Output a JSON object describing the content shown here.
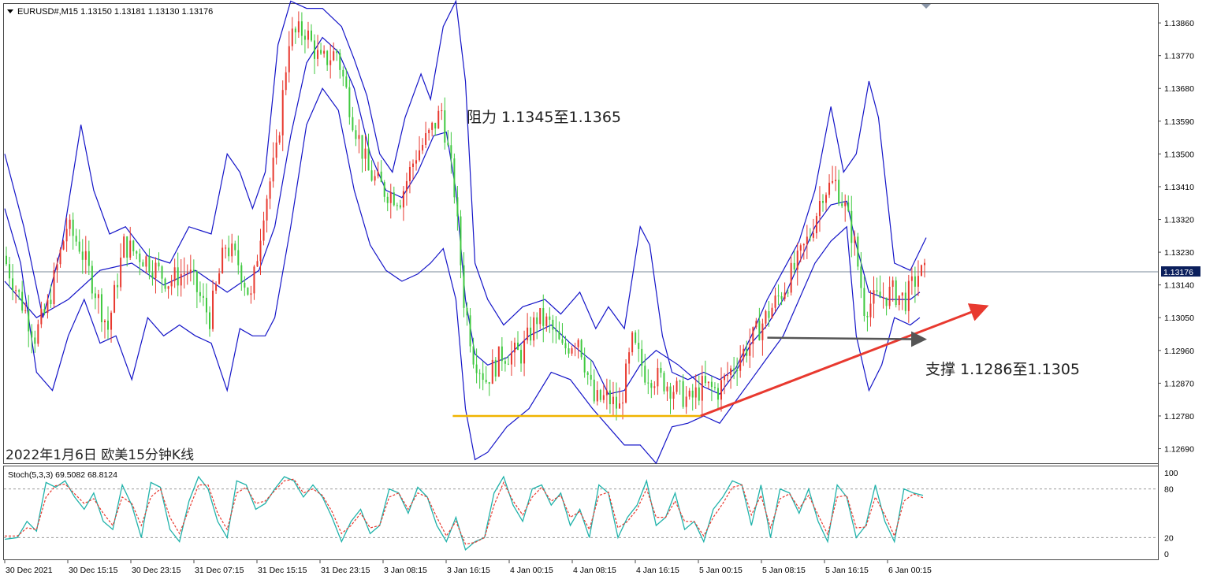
{
  "header": {
    "symbol_text": "EURUSD#,M15  1.13150 1.13181 1.13130 1.13176"
  },
  "stoch": {
    "label": "Stoch(5,3,3) 69.5082 68.8124",
    "levels": [
      100,
      80,
      20,
      0
    ]
  },
  "annotations": {
    "resistance": "阻力 1.1345至1.1365",
    "support": "支撑 1.1286至1.1305",
    "chart_date": "2022年1月6日 欧美15分钟K线"
  },
  "colors": {
    "bull": "#e8392f",
    "bear": "#3fc93f",
    "bands": "#1414c8",
    "support_arrow": "#e8392f",
    "horizontal_arrow": "#555555",
    "base_line": "#f0b400",
    "stoch_main": "#20b2aa",
    "stoch_signal": "#e8392f",
    "price_line": "#7a8a9a"
  },
  "chart_data": {
    "type": "candlestick",
    "ylim": [
      1.1265,
      1.1391
    ],
    "y_ticks": [
      "1.13860",
      "1.13770",
      "1.13680",
      "1.13590",
      "1.13500",
      "1.13410",
      "1.13320",
      "1.13230",
      "1.13140",
      "1.13050",
      "1.12960",
      "1.12870",
      "1.12780",
      "1.12690"
    ],
    "current_price": "1.13176",
    "x_labels": [
      "30 Dec 2021",
      "30 Dec 15:15",
      "30 Dec 23:15",
      "31 Dec 07:15",
      "31 Dec 15:15",
      "31 Dec 23:15",
      "3 Jan 08:15",
      "3 Jan 16:15",
      "4 Jan 00:15",
      "4 Jan 08:15",
      "4 Jan 16:15",
      "5 Jan 00:15",
      "5 Jan 08:15",
      "5 Jan 16:15",
      "6 Jan 00:15"
    ],
    "middle_band": [
      [
        0,
        1.1315
      ],
      [
        10,
        1.1305
      ],
      [
        20,
        1.131
      ],
      [
        30,
        1.1318
      ],
      [
        40,
        1.132
      ],
      [
        50,
        1.1314
      ],
      [
        60,
        1.1318
      ],
      [
        70,
        1.1312
      ],
      [
        80,
        1.1318
      ],
      [
        85,
        1.133
      ],
      [
        90,
        1.1355
      ],
      [
        95,
        1.1375
      ],
      [
        100,
        1.1382
      ],
      [
        105,
        1.1378
      ],
      [
        110,
        1.1368
      ],
      [
        115,
        1.135
      ],
      [
        120,
        1.134
      ],
      [
        125,
        1.1338
      ],
      [
        130,
        1.1345
      ],
      [
        135,
        1.1355
      ],
      [
        139,
        1.1356
      ],
      [
        142,
        1.134
      ],
      [
        145,
        1.131
      ],
      [
        148,
        1.1295
      ],
      [
        152,
        1.1292
      ],
      [
        158,
        1.1294
      ],
      [
        165,
        1.13
      ],
      [
        172,
        1.1303
      ],
      [
        178,
        1.1298
      ],
      [
        185,
        1.1293
      ],
      [
        190,
        1.1284
      ],
      [
        195,
        1.1285
      ],
      [
        200,
        1.1292
      ],
      [
        205,
        1.1296
      ],
      [
        212,
        1.1292
      ],
      [
        220,
        1.1286
      ],
      [
        225,
        1.1284
      ],
      [
        230,
        1.129
      ],
      [
        235,
        1.1298
      ],
      [
        240,
        1.1303
      ],
      [
        245,
        1.131
      ],
      [
        250,
        1.132
      ],
      [
        255,
        1.133
      ],
      [
        260,
        1.1336
      ],
      [
        265,
        1.1337
      ],
      [
        268,
        1.1325
      ],
      [
        272,
        1.1312
      ],
      [
        278,
        1.131
      ],
      [
        285,
        1.131
      ],
      [
        288,
        1.1312
      ]
    ],
    "upper_band": [
      [
        0,
        1.135
      ],
      [
        6,
        1.133
      ],
      [
        12,
        1.1305
      ],
      [
        18,
        1.1325
      ],
      [
        24,
        1.1358
      ],
      [
        28,
        1.134
      ],
      [
        33,
        1.1328
      ],
      [
        38,
        1.133
      ],
      [
        45,
        1.1322
      ],
      [
        52,
        1.132
      ],
      [
        58,
        1.133
      ],
      [
        65,
        1.1328
      ],
      [
        70,
        1.135
      ],
      [
        74,
        1.1345
      ],
      [
        78,
        1.1335
      ],
      [
        82,
        1.1345
      ],
      [
        86,
        1.138
      ],
      [
        90,
        1.1392
      ],
      [
        95,
        1.139
      ],
      [
        100,
        1.139
      ],
      [
        106,
        1.1385
      ],
      [
        110,
        1.1376
      ],
      [
        114,
        1.1366
      ],
      [
        118,
        1.135
      ],
      [
        122,
        1.1345
      ],
      [
        126,
        1.136
      ],
      [
        131,
        1.1372
      ],
      [
        134,
        1.1365
      ],
      [
        138,
        1.1385
      ],
      [
        142,
        1.1392
      ],
      [
        145,
        1.137
      ],
      [
        148,
        1.132
      ],
      [
        152,
        1.131
      ],
      [
        157,
        1.1303
      ],
      [
        163,
        1.1308
      ],
      [
        170,
        1.131
      ],
      [
        175,
        1.1306
      ],
      [
        181,
        1.1312
      ],
      [
        186,
        1.1302
      ],
      [
        190,
        1.1308
      ],
      [
        195,
        1.1302
      ],
      [
        200,
        1.133
      ],
      [
        203,
        1.1325
      ],
      [
        207,
        1.13
      ],
      [
        210,
        1.129
      ],
      [
        215,
        1.1288
      ],
      [
        220,
        1.129
      ],
      [
        225,
        1.1288
      ],
      [
        230,
        1.1291
      ],
      [
        235,
        1.13
      ],
      [
        240,
        1.131
      ],
      [
        245,
        1.1318
      ],
      [
        250,
        1.1326
      ],
      [
        255,
        1.134
      ],
      [
        260,
        1.1363
      ],
      [
        264,
        1.1345
      ],
      [
        268,
        1.135
      ],
      [
        272,
        1.137
      ],
      [
        275,
        1.136
      ],
      [
        280,
        1.132
      ],
      [
        285,
        1.1318
      ],
      [
        290,
        1.1327
      ]
    ],
    "lower_band": [
      [
        0,
        1.1335
      ],
      [
        5,
        1.132
      ],
      [
        10,
        1.129
      ],
      [
        15,
        1.1285
      ],
      [
        20,
        1.13
      ],
      [
        25,
        1.131
      ],
      [
        30,
        1.1298
      ],
      [
        35,
        1.13
      ],
      [
        40,
        1.1288
      ],
      [
        45,
        1.1305
      ],
      [
        50,
        1.13
      ],
      [
        55,
        1.1303
      ],
      [
        60,
        1.13
      ],
      [
        65,
        1.1298
      ],
      [
        70,
        1.1285
      ],
      [
        74,
        1.1302
      ],
      [
        78,
        1.13
      ],
      [
        82,
        1.13
      ],
      [
        85,
        1.1305
      ],
      [
        90,
        1.133
      ],
      [
        95,
        1.1358
      ],
      [
        100,
        1.1368
      ],
      [
        105,
        1.1362
      ],
      [
        110,
        1.134
      ],
      [
        115,
        1.1325
      ],
      [
        120,
        1.1318
      ],
      [
        125,
        1.1315
      ],
      [
        130,
        1.1317
      ],
      [
        134,
        1.132
      ],
      [
        138,
        1.1324
      ],
      [
        142,
        1.131
      ],
      [
        145,
        1.128
      ],
      [
        148,
        1.1266
      ],
      [
        152,
        1.1268
      ],
      [
        158,
        1.1275
      ],
      [
        165,
        1.128
      ],
      [
        172,
        1.129
      ],
      [
        178,
        1.1288
      ],
      [
        185,
        1.128
      ],
      [
        190,
        1.1275
      ],
      [
        195,
        1.127
      ],
      [
        200,
        1.127
      ],
      [
        205,
        1.1265
      ],
      [
        210,
        1.1275
      ],
      [
        215,
        1.1276
      ],
      [
        220,
        1.1278
      ],
      [
        225,
        1.1276
      ],
      [
        230,
        1.1282
      ],
      [
        235,
        1.1288
      ],
      [
        240,
        1.1294
      ],
      [
        245,
        1.13
      ],
      [
        250,
        1.131
      ],
      [
        255,
        1.132
      ],
      [
        260,
        1.1326
      ],
      [
        265,
        1.133
      ],
      [
        268,
        1.13
      ],
      [
        272,
        1.1285
      ],
      [
        276,
        1.1292
      ],
      [
        280,
        1.1305
      ],
      [
        285,
        1.1303
      ],
      [
        288,
        1.1305
      ]
    ],
    "close_path": [
      [
        0,
        1.1322
      ],
      [
        10,
        1.13
      ],
      [
        14,
        1.1308
      ],
      [
        20,
        1.133
      ],
      [
        24,
        1.1325
      ],
      [
        28,
        1.1315
      ],
      [
        33,
        1.1302
      ],
      [
        38,
        1.1325
      ],
      [
        45,
        1.1321
      ],
      [
        52,
        1.1315
      ],
      [
        58,
        1.1318
      ],
      [
        65,
        1.1305
      ],
      [
        70,
        1.1325
      ],
      [
        74,
        1.132
      ],
      [
        78,
        1.131
      ],
      [
        82,
        1.1335
      ],
      [
        86,
        1.135
      ],
      [
        90,
        1.1382
      ],
      [
        95,
        1.1384
      ],
      [
        100,
        1.1375
      ],
      [
        105,
        1.1378
      ],
      [
        110,
        1.136
      ],
      [
        115,
        1.1345
      ],
      [
        120,
        1.134
      ],
      [
        125,
        1.1338
      ],
      [
        130,
        1.135
      ],
      [
        134,
        1.1355
      ],
      [
        138,
        1.1362
      ],
      [
        142,
        1.134
      ],
      [
        145,
        1.131
      ],
      [
        148,
        1.1295
      ],
      [
        152,
        1.1288
      ],
      [
        157,
        1.1295
      ],
      [
        163,
        1.1295
      ],
      [
        168,
        1.1305
      ],
      [
        172,
        1.1303
      ],
      [
        176,
        1.1296
      ],
      [
        181,
        1.13
      ],
      [
        186,
        1.1282
      ],
      [
        190,
        1.1283
      ],
      [
        194,
        1.128
      ],
      [
        198,
        1.1298
      ],
      [
        202,
        1.129
      ],
      [
        207,
        1.1288
      ],
      [
        212,
        1.1285
      ],
      [
        216,
        1.1282
      ],
      [
        220,
        1.1286
      ],
      [
        225,
        1.1285
      ],
      [
        230,
        1.1292
      ],
      [
        235,
        1.1298
      ],
      [
        240,
        1.1305
      ],
      [
        245,
        1.1312
      ],
      [
        250,
        1.132
      ],
      [
        254,
        1.1328
      ],
      [
        258,
        1.134
      ],
      [
        262,
        1.1342
      ],
      [
        265,
        1.1335
      ],
      [
        268,
        1.1325
      ],
      [
        271,
        1.1308
      ],
      [
        275,
        1.131
      ],
      [
        280,
        1.1312
      ],
      [
        284,
        1.131
      ],
      [
        288,
        1.1317
      ]
    ],
    "stoch_values": [
      [
        0,
        18
      ],
      [
        4,
        20
      ],
      [
        7,
        40
      ],
      [
        10,
        28
      ],
      [
        13,
        88
      ],
      [
        16,
        82
      ],
      [
        19,
        90
      ],
      [
        22,
        70
      ],
      [
        25,
        55
      ],
      [
        28,
        75
      ],
      [
        31,
        40
      ],
      [
        34,
        30
      ],
      [
        37,
        85
      ],
      [
        40,
        60
      ],
      [
        43,
        20
      ],
      [
        46,
        88
      ],
      [
        49,
        82
      ],
      [
        52,
        30
      ],
      [
        55,
        15
      ],
      [
        58,
        65
      ],
      [
        61,
        95
      ],
      [
        64,
        80
      ],
      [
        67,
        40
      ],
      [
        70,
        20
      ],
      [
        73,
        90
      ],
      [
        76,
        85
      ],
      [
        79,
        55
      ],
      [
        82,
        62
      ],
      [
        85,
        80
      ],
      [
        88,
        95
      ],
      [
        91,
        90
      ],
      [
        94,
        70
      ],
      [
        97,
        85
      ],
      [
        100,
        70
      ],
      [
        103,
        45
      ],
      [
        106,
        15
      ],
      [
        109,
        40
      ],
      [
        112,
        55
      ],
      [
        115,
        25
      ],
      [
        118,
        35
      ],
      [
        121,
        80
      ],
      [
        124,
        75
      ],
      [
        127,
        50
      ],
      [
        130,
        82
      ],
      [
        133,
        70
      ],
      [
        136,
        35
      ],
      [
        139,
        15
      ],
      [
        142,
        45
      ],
      [
        145,
        5
      ],
      [
        148,
        15
      ],
      [
        151,
        20
      ],
      [
        154,
        75
      ],
      [
        157,
        95
      ],
      [
        160,
        60
      ],
      [
        163,
        40
      ],
      [
        166,
        80
      ],
      [
        169,
        85
      ],
      [
        172,
        60
      ],
      [
        175,
        75
      ],
      [
        178,
        35
      ],
      [
        181,
        55
      ],
      [
        184,
        20
      ],
      [
        187,
        85
      ],
      [
        190,
        75
      ],
      [
        193,
        20
      ],
      [
        196,
        45
      ],
      [
        199,
        60
      ],
      [
        202,
        90
      ],
      [
        205,
        35
      ],
      [
        208,
        45
      ],
      [
        211,
        75
      ],
      [
        214,
        30
      ],
      [
        217,
        40
      ],
      [
        220,
        15
      ],
      [
        223,
        55
      ],
      [
        226,
        70
      ],
      [
        229,
        90
      ],
      [
        232,
        85
      ],
      [
        235,
        35
      ],
      [
        238,
        85
      ],
      [
        241,
        20
      ],
      [
        244,
        80
      ],
      [
        247,
        75
      ],
      [
        250,
        50
      ],
      [
        253,
        80
      ],
      [
        256,
        40
      ],
      [
        259,
        15
      ],
      [
        262,
        85
      ],
      [
        265,
        70
      ],
      [
        268,
        20
      ],
      [
        271,
        35
      ],
      [
        274,
        85
      ],
      [
        277,
        40
      ],
      [
        280,
        15
      ],
      [
        283,
        80
      ],
      [
        286,
        75
      ],
      [
        289,
        72
      ]
    ],
    "stoch_signal": [
      [
        0,
        22
      ],
      [
        4,
        22
      ],
      [
        7,
        32
      ],
      [
        10,
        30
      ],
      [
        13,
        70
      ],
      [
        16,
        84
      ],
      [
        19,
        86
      ],
      [
        22,
        74
      ],
      [
        25,
        62
      ],
      [
        28,
        68
      ],
      [
        31,
        50
      ],
      [
        34,
        35
      ],
      [
        37,
        70
      ],
      [
        40,
        62
      ],
      [
        43,
        35
      ],
      [
        46,
        70
      ],
      [
        49,
        80
      ],
      [
        52,
        45
      ],
      [
        55,
        25
      ],
      [
        58,
        55
      ],
      [
        61,
        85
      ],
      [
        64,
        85
      ],
      [
        67,
        50
      ],
      [
        70,
        30
      ],
      [
        73,
        75
      ],
      [
        76,
        82
      ],
      [
        79,
        62
      ],
      [
        82,
        65
      ],
      [
        85,
        78
      ],
      [
        88,
        90
      ],
      [
        91,
        92
      ],
      [
        94,
        75
      ],
      [
        97,
        80
      ],
      [
        100,
        72
      ],
      [
        103,
        52
      ],
      [
        106,
        25
      ],
      [
        109,
        35
      ],
      [
        112,
        50
      ],
      [
        115,
        32
      ],
      [
        118,
        35
      ],
      [
        121,
        70
      ],
      [
        124,
        75
      ],
      [
        127,
        55
      ],
      [
        130,
        75
      ],
      [
        133,
        70
      ],
      [
        136,
        45
      ],
      [
        139,
        22
      ],
      [
        142,
        40
      ],
      [
        145,
        12
      ],
      [
        148,
        14
      ],
      [
        151,
        20
      ],
      [
        154,
        60
      ],
      [
        157,
        88
      ],
      [
        160,
        65
      ],
      [
        163,
        48
      ],
      [
        166,
        70
      ],
      [
        169,
        82
      ],
      [
        172,
        65
      ],
      [
        175,
        72
      ],
      [
        178,
        45
      ],
      [
        181,
        52
      ],
      [
        184,
        30
      ],
      [
        187,
        72
      ],
      [
        190,
        76
      ],
      [
        193,
        32
      ],
      [
        196,
        40
      ],
      [
        199,
        55
      ],
      [
        202,
        80
      ],
      [
        205,
        45
      ],
      [
        208,
        45
      ],
      [
        211,
        65
      ],
      [
        214,
        40
      ],
      [
        217,
        40
      ],
      [
        220,
        22
      ],
      [
        223,
        45
      ],
      [
        226,
        62
      ],
      [
        229,
        82
      ],
      [
        232,
        85
      ],
      [
        235,
        48
      ],
      [
        238,
        72
      ],
      [
        241,
        32
      ],
      [
        244,
        68
      ],
      [
        247,
        74
      ],
      [
        250,
        56
      ],
      [
        253,
        72
      ],
      [
        256,
        48
      ],
      [
        259,
        24
      ],
      [
        262,
        70
      ],
      [
        265,
        72
      ],
      [
        268,
        32
      ],
      [
        271,
        33
      ],
      [
        274,
        70
      ],
      [
        277,
        48
      ],
      [
        280,
        22
      ],
      [
        283,
        65
      ],
      [
        286,
        74
      ],
      [
        289,
        69
      ]
    ],
    "resistance_zone": [
      1.1345,
      1.1365
    ],
    "support_zone": [
      1.1286,
      1.1305
    ]
  }
}
